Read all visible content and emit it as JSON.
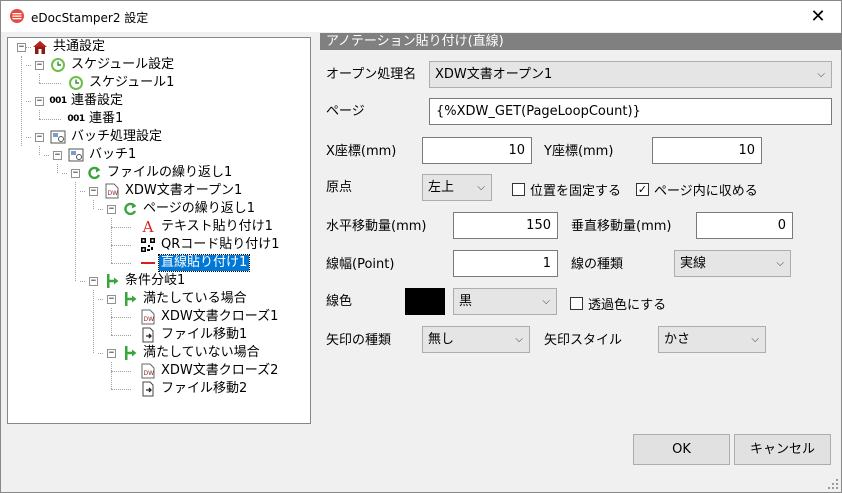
{
  "window": {
    "title": "eDocStamper2 設定"
  },
  "tree": {
    "nodes": [
      {
        "label": "共通設定",
        "icon": "house-icon"
      },
      {
        "label": "スケジュール設定",
        "icon": "clock-icon"
      },
      {
        "label": "スケジュール1",
        "icon": "clock-icon"
      },
      {
        "label": "連番設定",
        "icon": "number-icon",
        "icon_text": "001"
      },
      {
        "label": "連番1",
        "icon": "number-icon",
        "icon_text": "001"
      },
      {
        "label": "バッチ処理設定",
        "icon": "batch-icon"
      },
      {
        "label": "バッチ1",
        "icon": "batch-icon"
      },
      {
        "label": "ファイルの繰り返し1",
        "icon": "loop-icon"
      },
      {
        "label": "XDW文書オープン1",
        "icon": "xdw-doc-icon",
        "icon_text": "DW"
      },
      {
        "label": "ページの繰り返し1",
        "icon": "loop-icon"
      },
      {
        "label": "テキスト貼り付け1",
        "icon": "text-a-icon",
        "icon_text": "A"
      },
      {
        "label": "QRコード貼り付け1",
        "icon": "qr-code-icon"
      },
      {
        "label": "直線貼り付け1",
        "icon": "line-icon"
      },
      {
        "label": "条件分岐1",
        "icon": "branch-icon"
      },
      {
        "label": "満たしている場合",
        "icon": "branch-icon"
      },
      {
        "label": "XDW文書クローズ1",
        "icon": "xdw-doc-icon",
        "icon_text": "DW"
      },
      {
        "label": "ファイル移動1",
        "icon": "file-move-icon"
      },
      {
        "label": "満たしていない場合",
        "icon": "branch-icon"
      },
      {
        "label": "XDW文書クローズ2",
        "icon": "xdw-doc-icon",
        "icon_text": "DW"
      },
      {
        "label": "ファイル移動2",
        "icon": "file-move-icon"
      }
    ],
    "selected_index": 12
  },
  "panel": {
    "header": "アノテーション貼り付け(直線)",
    "open_label": "オープン処理名",
    "open_value": "XDW文書オープン1",
    "page_label": "ページ",
    "page_value": "{%XDW_GET(PageLoopCount)}",
    "x_label": "X座標(mm)",
    "x_value": "10",
    "y_label": "Y座標(mm)",
    "y_value": "10",
    "origin_label": "原点",
    "origin_value": "左上",
    "fix_pos_label": "位置を固定する",
    "fix_pos_checked": false,
    "fit_page_label": "ページ内に収める",
    "fit_page_checked": true,
    "hmove_label": "水平移動量(mm)",
    "hmove_value": "150",
    "vmove_label": "垂直移動量(mm)",
    "vmove_value": "0",
    "width_label": "線幅(Point)",
    "width_value": "1",
    "line_type_label": "線の種類",
    "line_type_value": "実線",
    "color_label": "線色",
    "color_hex": "#000000",
    "color_value": "黒",
    "transparent_label": "透過色にする",
    "transparent_checked": false,
    "arrow_type_label": "矢印の種類",
    "arrow_type_value": "無し",
    "arrow_style_label": "矢印スタイル",
    "arrow_style_value": "かさ"
  },
  "buttons": {
    "ok": "OK",
    "cancel": "キャンセル"
  },
  "colors": {
    "selection": "#0078d7",
    "header_bg": "#808080"
  }
}
